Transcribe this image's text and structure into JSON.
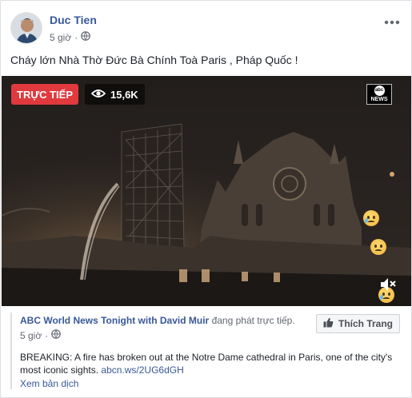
{
  "post": {
    "author": "Duc Tien",
    "time": "5 giờ",
    "text": "Cháy lớn Nhà Thờ Đức Bà Chính Toà Paris , Pháp Quốc !",
    "more_icon": "ellipsis-icon",
    "privacy_icon": "globe-icon"
  },
  "video": {
    "live_label": "TRỰC TIẾP",
    "viewers": "15,6K",
    "viewers_icon": "eye-icon",
    "broadcaster_logo_top": "abc",
    "broadcaster_logo_bottom": "NEWS",
    "floating_reactions": [
      "sad-reaction-icon",
      "sad-reaction-icon",
      "sad-reaction-icon"
    ],
    "mute_icon": "speaker-muted-icon"
  },
  "share": {
    "page_name": "ABC World News Tonight with David Muir",
    "action": "đang phát trực tiếp.",
    "time": "5 giờ",
    "like_page_label": "Thích Trang",
    "like_icon": "thumbs-up-icon",
    "description": "BREAKING: A fire has broken out at the Notre Dame cathedral in Paris, one of the city's most iconic sights.",
    "link": "abcn.ws/2UG6dGH",
    "translate_label": "Xem bản dịch"
  },
  "colors": {
    "link_blue": "#385898",
    "live_red": "#e0393e",
    "meta_gray": "#616770"
  }
}
